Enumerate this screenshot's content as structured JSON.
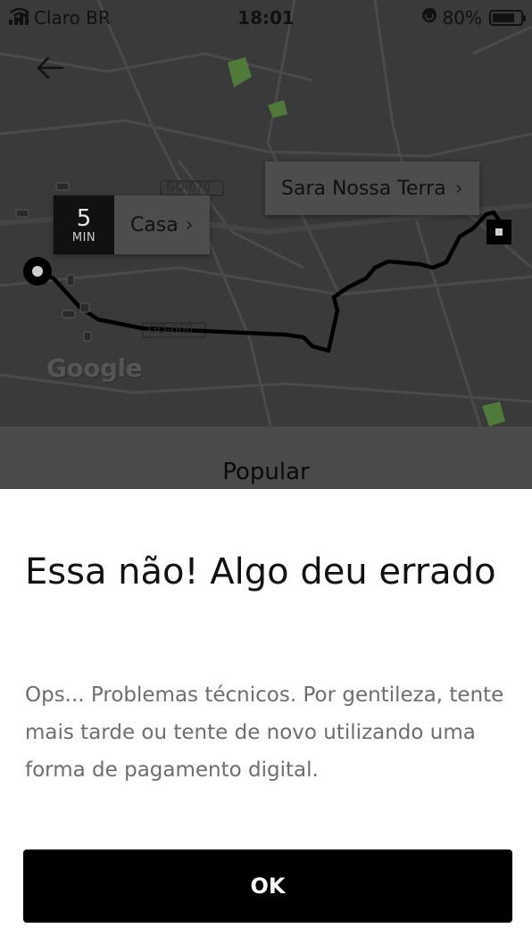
{
  "status_bar": {
    "carrier": "Claro BR",
    "time": "18:01",
    "battery": "80%",
    "battery_level": 0.8
  },
  "map": {
    "eta_number": "5",
    "eta_unit": "MIN",
    "pickup_label": "Casa",
    "destination_label": "Sara Nossa Terra",
    "road_labels": [
      "GO-070",
      "GO-060"
    ],
    "attribution": "Google"
  },
  "product": {
    "name": "Popular"
  },
  "dialog": {
    "title": "Essa não! Algo deu errado",
    "message": "Ops... Problemas técnicos. Por gentileza, tente mais tarde ou tente de novo utilizando uma forma de pagamento digital.",
    "ok_label": "OK"
  },
  "colors": {
    "map_overlay": "#3a3a3a",
    "route": "#000000",
    "park": "#4f7a3a",
    "button": "#000000"
  },
  "icons": [
    "signal-icon",
    "wifi-icon",
    "lock-rotation-icon",
    "location-arrow-icon",
    "alarm-icon",
    "battery-icon",
    "back-arrow-icon",
    "chevron-right-icon",
    "pickup-pin-icon",
    "destination-pin-icon",
    "car-icon"
  ]
}
